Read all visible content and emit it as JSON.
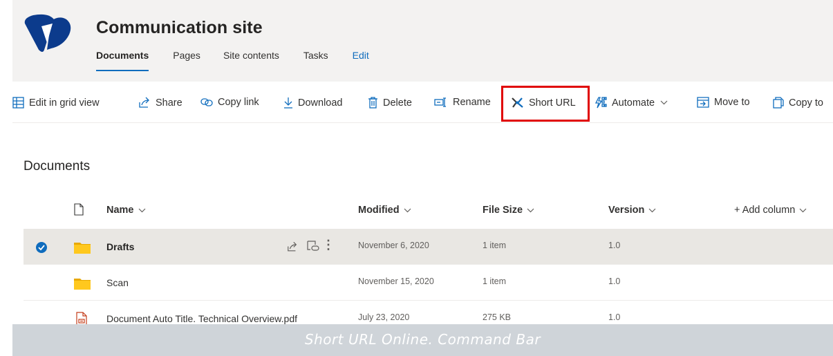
{
  "site": {
    "title": "Communication site",
    "nav": [
      {
        "label": "Documents",
        "active": true
      },
      {
        "label": "Pages"
      },
      {
        "label": "Site contents"
      },
      {
        "label": "Tasks"
      },
      {
        "label": "Edit"
      }
    ]
  },
  "commands": {
    "edit_grid": "Edit in grid view",
    "share": "Share",
    "copy_link": "Copy link",
    "download": "Download",
    "delete": "Delete",
    "rename": "Rename",
    "short_url": "Short URL",
    "automate": "Automate",
    "move_to": "Move to",
    "copy_to": "Copy to"
  },
  "library": {
    "title": "Documents",
    "columns": {
      "name": "Name",
      "modified": "Modified",
      "file_size": "File Size",
      "version": "Version",
      "add_column": "+ Add column"
    },
    "rows": [
      {
        "name": "Drafts",
        "modified": "November 6, 2020",
        "size": "1 item",
        "version": "1.0",
        "type": "folder",
        "selected": true
      },
      {
        "name": "Scan",
        "modified": "November 15, 2020",
        "size": "1 item",
        "version": "1.0",
        "type": "folder",
        "selected": false
      },
      {
        "name": "Document Auto Title. Technical Overview.pdf",
        "modified": "July 23, 2020",
        "size": "275 KB",
        "version": "1.0",
        "type": "pdf",
        "selected": false
      }
    ]
  },
  "caption": "Short URL Online. Command Bar",
  "colors": {
    "accent": "#0f6cbd",
    "highlight": "#e00000",
    "folder": "#ffb900",
    "header_bg": "#f3f2f1",
    "selected_row": "#e9e7e3",
    "caption_bar": "#cfd4d9"
  }
}
